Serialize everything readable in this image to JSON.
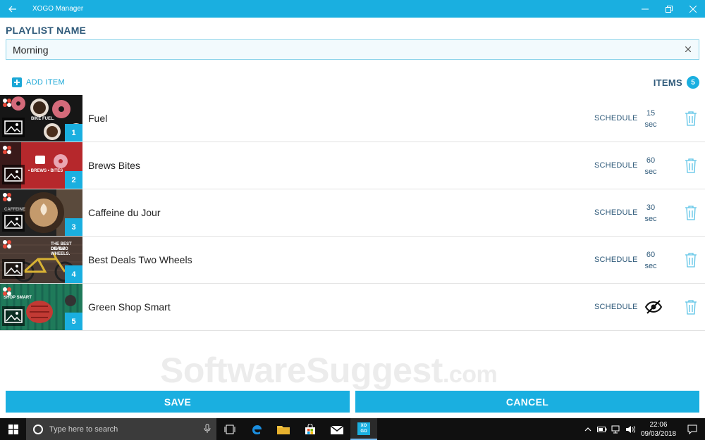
{
  "window": {
    "title": "XOGO Manager"
  },
  "playlist": {
    "label": "PLAYLIST NAME",
    "value": "Morning"
  },
  "toolbar": {
    "add_item_label": "ADD ITEM",
    "items_label": "ITEMS",
    "items_count": "5"
  },
  "thumb_texts": {
    "t1": "BIKE FUEL.",
    "t2": "• BREWS • BITES",
    "t3": "CAFFEINE",
    "t4a": "THE BEST DEALS",
    "t4b": "ON TWO WHEELS.",
    "t5a": "SHOP SMART"
  },
  "items": [
    {
      "number": "1",
      "name": "Fuel",
      "schedule": "SCHEDULE",
      "duration_value": "15",
      "duration_unit": "sec",
      "hidden": false
    },
    {
      "number": "2",
      "name": "Brews Bites",
      "schedule": "SCHEDULE",
      "duration_value": "60",
      "duration_unit": "sec",
      "hidden": false
    },
    {
      "number": "3",
      "name": "Caffeine du Jour",
      "schedule": "SCHEDULE",
      "duration_value": "30",
      "duration_unit": "sec",
      "hidden": false
    },
    {
      "number": "4",
      "name": "Best Deals Two Wheels",
      "schedule": "SCHEDULE",
      "duration_value": "60",
      "duration_unit": "sec",
      "hidden": false
    },
    {
      "number": "5",
      "name": "Green Shop Smart",
      "schedule": "SCHEDULE",
      "duration_value": "",
      "duration_unit": "",
      "hidden": true
    }
  ],
  "watermark": {
    "main": "SoftwareSuggest",
    "suffix": ".com"
  },
  "buttons": {
    "save": "SAVE",
    "cancel": "CANCEL"
  },
  "taskbar": {
    "search_placeholder": "Type here to search",
    "time": "22:06",
    "date": "09/03/2018",
    "xogo_label": "XO GO"
  },
  "colors": {
    "accent": "#1aafe0",
    "heading": "#2f5a7a",
    "taskbar": "#101010"
  }
}
